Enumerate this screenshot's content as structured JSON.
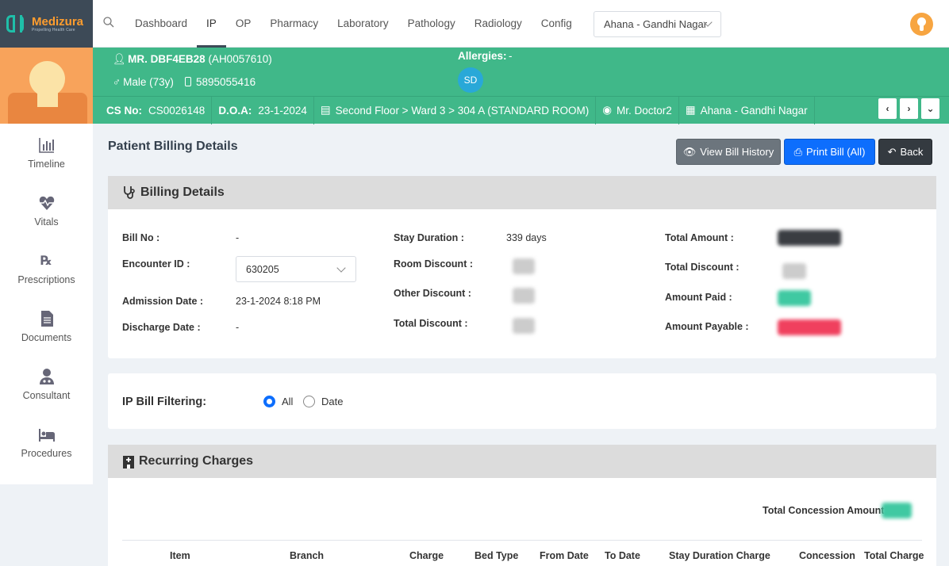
{
  "brand": {
    "name": "Medizura",
    "tagline": "Propelling Health Care"
  },
  "nav": {
    "tabs": [
      {
        "label": "Dashboard"
      },
      {
        "label": "IP"
      },
      {
        "label": "OP"
      },
      {
        "label": "Pharmacy"
      },
      {
        "label": "Laboratory"
      },
      {
        "label": "Pathology"
      },
      {
        "label": "Radiology"
      },
      {
        "label": "Config"
      }
    ],
    "active": "IP"
  },
  "branch": {
    "selected": "Ahana - Gandhi Nagar"
  },
  "patient": {
    "name": "MR. DBF4EB28",
    "id": "(AH0057610)",
    "gender_age": "Male (73y)",
    "phone": "5895055416",
    "allergies_label": "Allergies:",
    "allergies_value": "-",
    "initials": "SD",
    "cs_label": "CS No:",
    "cs_value": "CS0026148",
    "doa_label": "D.O.A:",
    "doa_value": "23-1-2024",
    "room": "Second Floor > Ward 3 > 304 A (STANDARD ROOM)",
    "doctor": "Mr. Doctor2",
    "branch": "Ahana - Gandhi Nagar"
  },
  "sidebar": {
    "items": [
      {
        "label": "Timeline",
        "icon": "chart-icon"
      },
      {
        "label": "Vitals",
        "icon": "heartbeat-icon"
      },
      {
        "label": "Prescriptions",
        "icon": "rx-icon"
      },
      {
        "label": "Documents",
        "icon": "document-icon"
      },
      {
        "label": "Consultant",
        "icon": "doctor-icon"
      },
      {
        "label": "Procedures",
        "icon": "bed-icon"
      }
    ]
  },
  "page": {
    "title": "Patient Billing Details"
  },
  "actions": {
    "view_history": "View Bill History",
    "print": "Print Bill (All)",
    "back": "Back"
  },
  "billing": {
    "heading": "Billing Details",
    "bill_no_label": "Bill No :",
    "bill_no": "-",
    "encounter_label": "Encounter ID :",
    "encounter": "630205",
    "admission_label": "Admission Date :",
    "admission": "23-1-2024 8:18 PM",
    "discharge_label": "Discharge Date :",
    "discharge": "-",
    "stay_label": "Stay Duration :",
    "stay": "339 days",
    "room_disc_label": "Room Discount :",
    "other_disc_label": "Other Discount :",
    "total_disc_label": "Total Discount :",
    "total_amount_label": "Total Amount :",
    "total_discount_label": "Total Discount :",
    "amount_paid_label": "Amount Paid :",
    "amount_payable_label": "Amount Payable :"
  },
  "filter": {
    "label": "IP Bill Filtering:",
    "options": [
      "All",
      "Date"
    ],
    "selected": "All"
  },
  "recurring": {
    "heading": "Recurring Charges",
    "concession_label": "Total Concession Amount:",
    "columns": [
      "Item",
      "Branch",
      "Charge",
      "Bed Type",
      "From Date",
      "To Date",
      "Stay Duration Charge",
      "Concession",
      "Total Charge"
    ]
  },
  "colors": {
    "primary_green": "#40b889",
    "accent": "#0d6efd",
    "brand_dark": "#3d4a57",
    "brand_orange": "#ff9d2e"
  }
}
